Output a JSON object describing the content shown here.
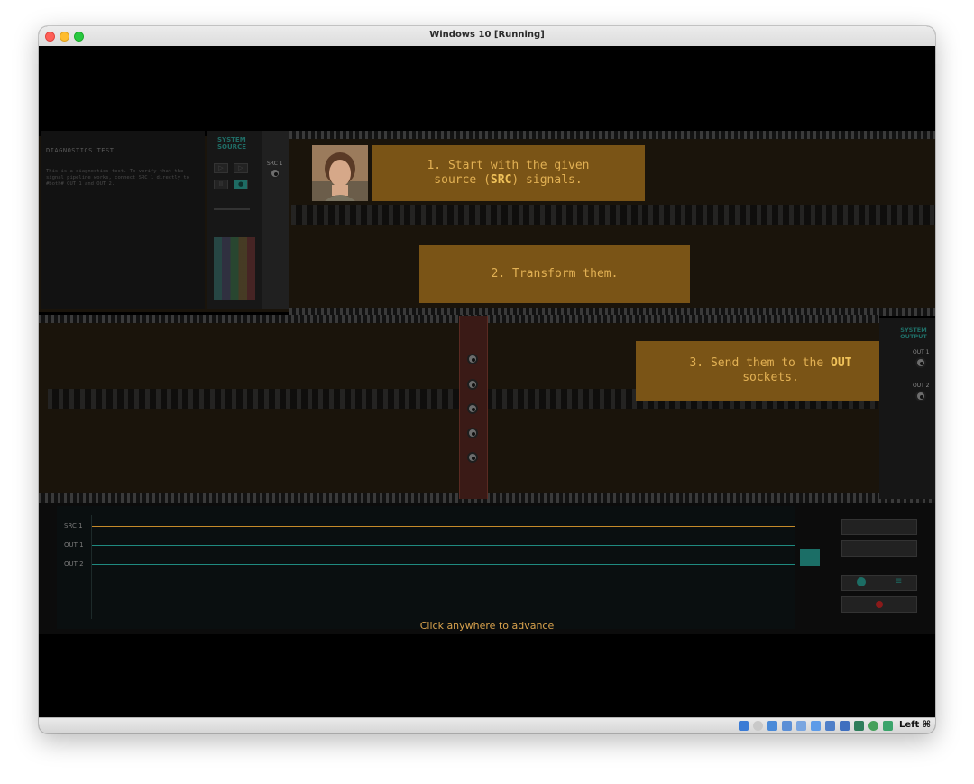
{
  "window": {
    "title": "Windows 10 [Running]"
  },
  "statusbar": {
    "host_key": "Left ⌘"
  },
  "game": {
    "diagnostics": {
      "title": "DIAGNOSTICS TEST",
      "body": "This is a diagnostics test. To verify that the signal pipeline works, connect SRC 1 directly to #both# OUT 1 and OUT 2."
    },
    "system_source": {
      "title": "SYSTEM SOURCE",
      "port_label": "SRC 1"
    },
    "tips": {
      "tip1_line1": "1. Start with the given",
      "tip1_pre": "source (",
      "tip1_bold": "SRC",
      "tip1_post": ") signals.",
      "tip2": "2. Transform them.",
      "tip3_pre": "3. Send them to the ",
      "tip3_bold": "OUT",
      "tip3_post": "sockets."
    },
    "system_output": {
      "title": "SYSTEM OUTPUT",
      "out1": "OUT 1",
      "out2": "OUT 2"
    },
    "scope": {
      "channels": [
        "SRC 1",
        "OUT 1",
        "OUT 2"
      ],
      "colors": {
        "src": "#c58a2a",
        "out": "#1f8a80"
      }
    },
    "advance_text": "Click anywhere to advance"
  }
}
